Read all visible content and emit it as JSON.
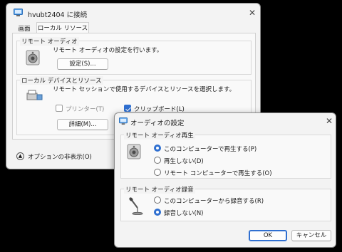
{
  "main_window": {
    "title": "hvubt2404 に接続",
    "tabs": [
      {
        "label": "画面"
      },
      {
        "label": "ローカル リソース"
      }
    ],
    "remote_audio": {
      "group_label": "リモート オーディオ",
      "description": "リモート オーディオの設定を行います。",
      "settings_button": "設定(S)..."
    },
    "local_devices": {
      "group_label": "ローカル デバイスとリソース",
      "description": "リモート セッションで使用するデバイスとリソースを選択します。",
      "printer_label": "プリンター(T)",
      "printer_checked": false,
      "clipboard_label": "クリップボード(L)",
      "clipboard_checked": true,
      "details_button": "詳細(M)..."
    },
    "options_toggle": "オプションの非表示(O)"
  },
  "audio_dialog": {
    "title": "オーディオの設定",
    "playback": {
      "group_label": "リモート オーディオ再生",
      "options": [
        {
          "label": "このコンピューターで再生する(P)",
          "selected": true
        },
        {
          "label": "再生しない(D)",
          "selected": false
        },
        {
          "label": "リモート コンピューターで再生する(O)",
          "selected": false
        }
      ]
    },
    "recording": {
      "group_label": "リモート オーディオ録音",
      "options": [
        {
          "label": "このコンピューターから録音する(R)",
          "selected": false
        },
        {
          "label": "録音しない(N)",
          "selected": true
        }
      ]
    },
    "ok_button": "OK",
    "cancel_button": "キャンセル"
  },
  "icons": {
    "app_icon": "remote-desktop-icon",
    "speaker": "speaker-icon",
    "devices": "devices-icon",
    "microphone": "microphone-icon",
    "close": "close-icon",
    "collapse": "chevron-up-icon"
  },
  "colors": {
    "accent": "#2f6fd0",
    "window_bg": "#f3f3f3",
    "backdrop": "#000000"
  }
}
